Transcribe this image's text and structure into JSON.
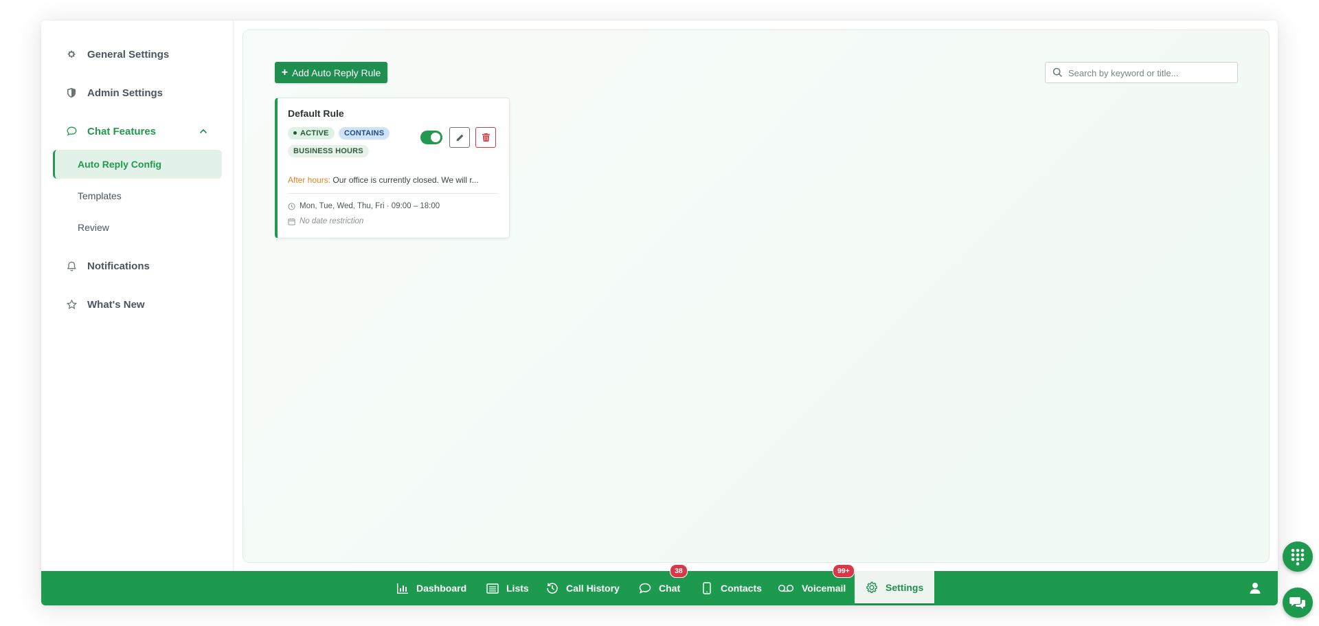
{
  "sidebar": {
    "general_settings": "General Settings",
    "admin_settings": "Admin Settings",
    "chat_features": "Chat Features",
    "sub_items": [
      "Auto Reply Config",
      "Templates",
      "Review"
    ],
    "notifications": "Notifications",
    "whats_new": "What's New"
  },
  "toolbar": {
    "add_rule_label": "Add Auto Reply Rule",
    "search_placeholder": "Search by keyword or title..."
  },
  "rule": {
    "title": "Default Rule",
    "status": "ACTIVE",
    "match_type": "CONTAINS",
    "scope": "BUSINESS HOURS",
    "enabled": true,
    "after_hours_label": "After hours:",
    "after_hours_message": "Our office is currently closed. We will r...",
    "schedule": "Mon, Tue, Wed, Thu, Fri · 09:00 – 18:00",
    "date_restriction": "No date restriction"
  },
  "bottom_nav": {
    "dashboard": "Dashboard",
    "lists": "Lists",
    "call_history": "Call History",
    "chat": "Chat",
    "chat_badge": "38",
    "contacts": "Contacts",
    "voicemail": "Voicemail",
    "voicemail_badge": "99+",
    "settings": "Settings"
  },
  "colors": {
    "brand_green": "#1e9a4f",
    "accent_green": "#22994f",
    "danger_red": "#d23a44",
    "after_hours_orange": "#d98320"
  },
  "icons": {
    "general_settings": "gear-icon",
    "admin_settings": "shield-icon",
    "chat_features": "chat-bubble-icon",
    "notifications": "bell-icon",
    "whats_new": "star-icon",
    "edit": "pencil-icon",
    "delete": "trash-icon",
    "dialpad": "dialpad-icon",
    "chat_support": "chat-support-icon"
  }
}
